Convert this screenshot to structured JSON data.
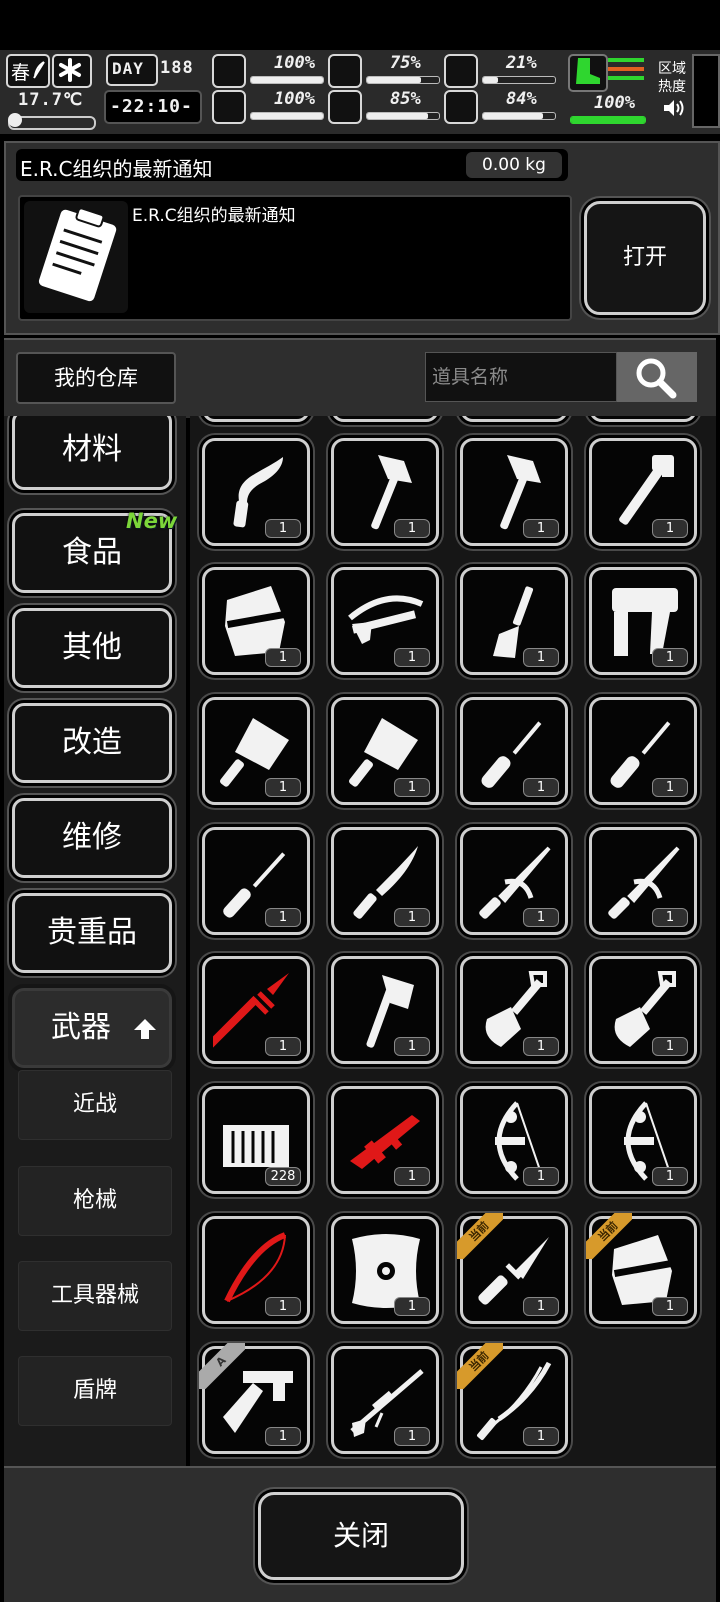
{
  "status": {
    "season": "春",
    "temperature": "17.7℃",
    "day_label": "DAY",
    "day_value": "188",
    "clock": "-22:10-",
    "stats": [
      {
        "icon": "medkit-icon",
        "value": "100%",
        "level": 1.0
      },
      {
        "icon": "stomach-icon",
        "value": "75%",
        "level": 0.75
      },
      {
        "icon": "fatigue-icon",
        "value": "21%",
        "level": 0.21
      },
      {
        "icon": "brain-icon",
        "value": "100%",
        "level": 1.0
      },
      {
        "icon": "water-drop-icon",
        "value": "85%",
        "level": 0.85
      },
      {
        "icon": "heart-icon",
        "value": "84%",
        "level": 0.84
      }
    ],
    "stamina_value": "100%",
    "stamina_level": 1.0,
    "zone_line1": "区域",
    "zone_line2": "热度"
  },
  "notice": {
    "title": "E.R.C组织的最新通知",
    "weight": "0.00 kg",
    "description": "E.R.C组织的最新通知",
    "icon": "clipboard-icon",
    "open_label": "打开"
  },
  "search": {
    "warehouse_label": "我的仓库",
    "placeholder": "道具名称"
  },
  "categories": [
    {
      "label": "材料"
    },
    {
      "label": "食品",
      "badge": "New"
    },
    {
      "label": "其他"
    },
    {
      "label": "改造"
    },
    {
      "label": "维修"
    },
    {
      "label": "贵重品"
    },
    {
      "label": "武器",
      "active": true
    }
  ],
  "subcategories": [
    "近战",
    "枪械",
    "工具器械",
    "盾牌"
  ],
  "items": [
    {
      "icon": "kukri-icon",
      "qty": "1"
    },
    {
      "icon": "hatchet-icon",
      "qty": "1"
    },
    {
      "icon": "hatchet-icon",
      "qty": "1"
    },
    {
      "icon": "pipe-wrench-icon",
      "qty": "1"
    },
    {
      "icon": "riot-shield-icon",
      "qty": "1"
    },
    {
      "icon": "crossbow-icon",
      "qty": "1"
    },
    {
      "icon": "scraper-icon",
      "qty": "1"
    },
    {
      "icon": "nail-gun-icon",
      "qty": "1"
    },
    {
      "icon": "cleaver-icon",
      "qty": "1"
    },
    {
      "icon": "cleaver-icon",
      "qty": "1"
    },
    {
      "icon": "screwdriver-icon",
      "qty": "1"
    },
    {
      "icon": "screwdriver-icon",
      "qty": "1"
    },
    {
      "icon": "ice-pick-icon",
      "qty": "1"
    },
    {
      "icon": "machete-icon",
      "qty": "1"
    },
    {
      "icon": "sabre-icon",
      "qty": "1"
    },
    {
      "icon": "sabre-icon",
      "qty": "1"
    },
    {
      "icon": "red-spear-icon",
      "qty": "1",
      "color": "#e01818"
    },
    {
      "icon": "axe-icon",
      "qty": "1"
    },
    {
      "icon": "shovel-icon",
      "qty": "1"
    },
    {
      "icon": "shovel-icon",
      "qty": "1"
    },
    {
      "icon": "ammo-crate-icon",
      "qty": "228"
    },
    {
      "icon": "red-rifle-icon",
      "qty": "1",
      "color": "#e01818"
    },
    {
      "icon": "compound-bow-icon",
      "qty": "1"
    },
    {
      "icon": "compound-bow-icon",
      "qty": "1"
    },
    {
      "icon": "red-bow-icon",
      "qty": "1",
      "color": "#e01818"
    },
    {
      "icon": "round-shield-icon",
      "qty": "1"
    },
    {
      "icon": "combat-knife-icon",
      "qty": "1",
      "ribbon": "当前"
    },
    {
      "icon": "riot-shield-icon",
      "qty": "1",
      "ribbon": "当前"
    },
    {
      "icon": "caliper-axe-icon",
      "qty": "1",
      "ribbon": "A"
    },
    {
      "icon": "sniper-rifle-icon",
      "qty": "1"
    },
    {
      "icon": "katana-icon",
      "qty": "1",
      "ribbon": "当前"
    }
  ],
  "close_label": "关闭"
}
